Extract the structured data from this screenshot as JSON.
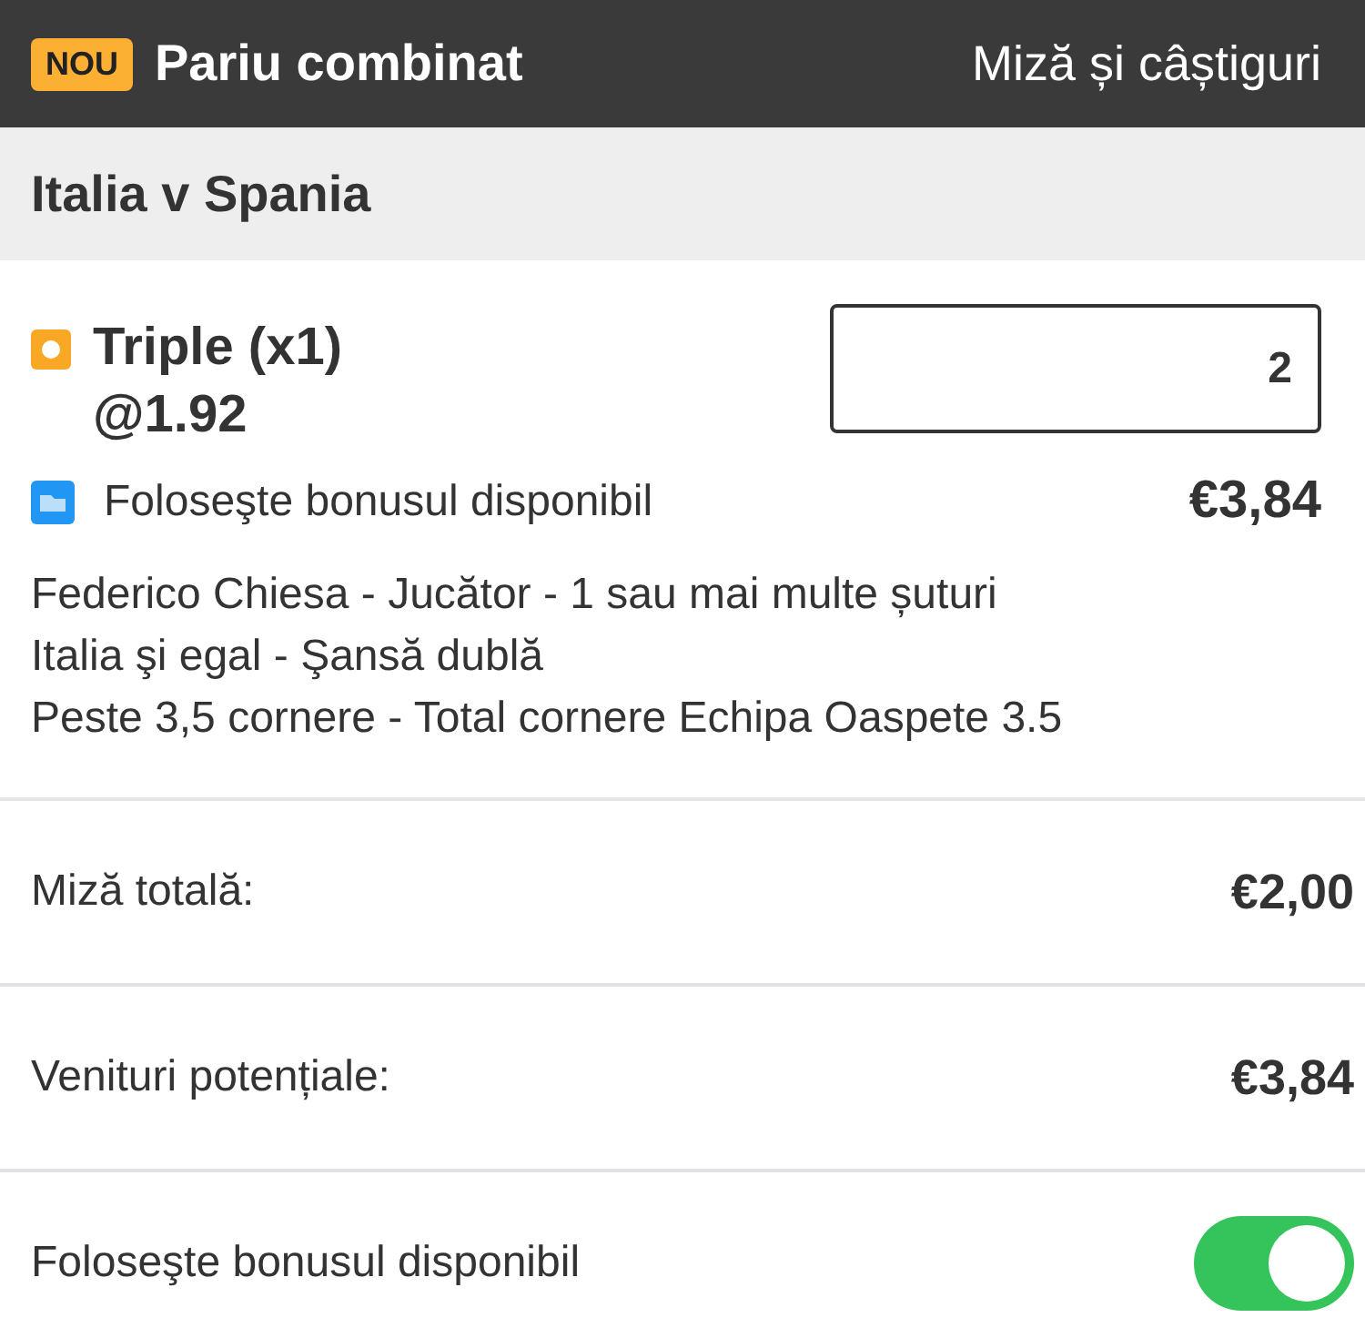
{
  "header": {
    "badge": "NOU",
    "title": "Pariu combinat",
    "action": "Miză și câștiguri"
  },
  "event": {
    "title": "Italia v Spania"
  },
  "bet": {
    "name": "Triple (x1)",
    "odds": "@1.92",
    "stake": "2",
    "bonus_label": "Foloseşte bonusul disponibil",
    "returns": "€3,84",
    "legs": [
      "Federico Chiesa - Jucător - 1 sau mai multe șuturi",
      "Italia şi egal - Şansă dublă",
      "Peste 3,5 cornere - Total cornere Echipa Oaspete 3.5"
    ]
  },
  "summary": [
    {
      "kind": "amount",
      "label": "Miză totală:",
      "value": "€2,00"
    },
    {
      "kind": "amount",
      "label": "Venituri potențiale:",
      "value": "€3,84"
    },
    {
      "kind": "toggle",
      "label": "Foloseşte bonusul disponibil",
      "on": true
    }
  ]
}
